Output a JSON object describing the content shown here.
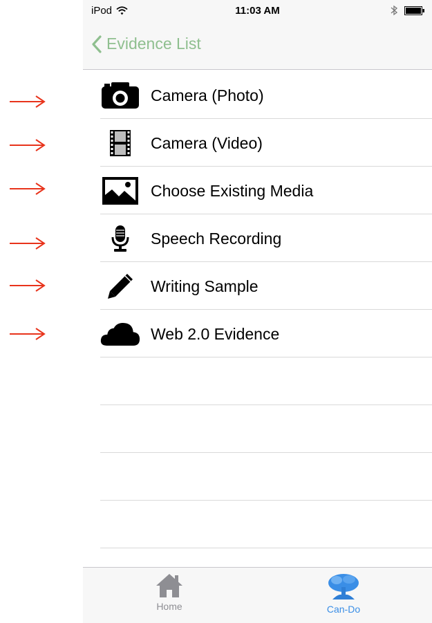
{
  "statusbar": {
    "carrier": "iPod",
    "time": "11:03 AM"
  },
  "navbar": {
    "back_label": "Evidence List"
  },
  "list": {
    "items": [
      {
        "label": "Camera (Photo)",
        "icon": "camera-icon"
      },
      {
        "label": "Camera (Video)",
        "icon": "film-icon"
      },
      {
        "label": "Choose Existing Media",
        "icon": "image-icon"
      },
      {
        "label": "Speech Recording",
        "icon": "microphone-icon"
      },
      {
        "label": "Writing Sample",
        "icon": "pencil-icon"
      },
      {
        "label": "Web 2.0 Evidence",
        "icon": "cloud-icon"
      }
    ]
  },
  "tabbar": {
    "tabs": [
      {
        "label": "Home",
        "icon": "home-icon",
        "active": false
      },
      {
        "label": "Can-Do",
        "icon": "tree-icon",
        "active": true
      }
    ]
  },
  "colors": {
    "accent_green": "#8fbf8f",
    "active_tab_blue": "#3a8ee6",
    "inactive_tab_gray": "#8e8e93",
    "annotation_red": "#e8331b"
  }
}
